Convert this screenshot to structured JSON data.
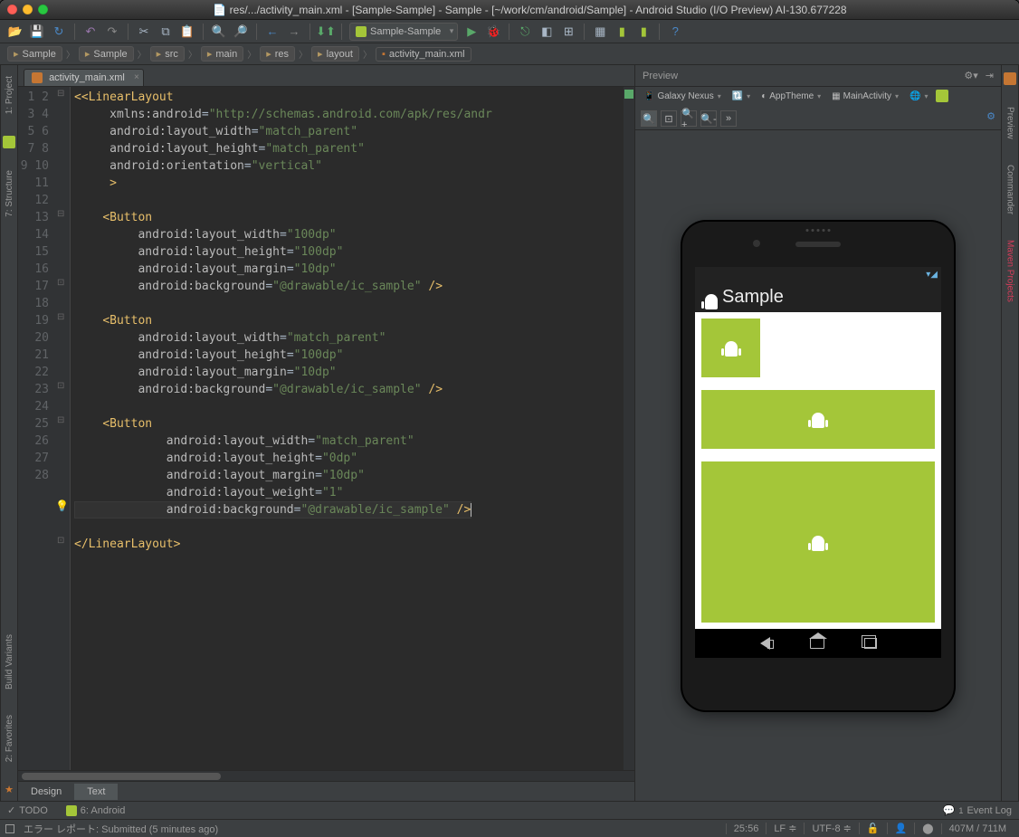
{
  "window": {
    "title": "res/.../activity_main.xml - [Sample-Sample] - Sample - [~/work/cm/android/Sample] - Android Studio (I/O Preview) AI-130.677228"
  },
  "toolbar": {
    "config": "Sample-Sample"
  },
  "breadcrumb": [
    "Sample",
    "Sample",
    "src",
    "main",
    "res",
    "layout",
    "activity_main.xml"
  ],
  "editor": {
    "tab": "activity_main.xml",
    "bottom_tabs": {
      "design": "Design",
      "text": "Text"
    },
    "line_count": 28,
    "cursor_line": 25,
    "code": {
      "l1": "<LinearLayout",
      "l2a": "xmlns:android",
      "l2b": "\"http://schemas.android.com/apk/res/andr",
      "l3a": "android:layout_width",
      "l3b": "\"match_parent\"",
      "l4a": "android:layout_height",
      "l4b": "\"match_parent\"",
      "l5a": "android:orientation",
      "l5b": "\"vertical\"",
      "l6": ">",
      "l8": "<Button",
      "l9a": "android:layout_width",
      "l9b": "\"100dp\"",
      "l10a": "android:layout_height",
      "l10b": "\"100dp\"",
      "l11a": "android:layout_margin",
      "l11b": "\"10dp\"",
      "l12a": "android:background",
      "l12b": "\"@drawable/ic_sample\"",
      "l12c": " />",
      "l14": "<Button",
      "l15a": "android:layout_width",
      "l15b": "\"match_parent\"",
      "l16a": "android:layout_height",
      "l16b": "\"100dp\"",
      "l17a": "android:layout_margin",
      "l17b": "\"10dp\"",
      "l18a": "android:background",
      "l18b": "\"@drawable/ic_sample\"",
      "l18c": " />",
      "l20": "<Button",
      "l21a": "android:layout_width",
      "l21b": "\"match_parent\"",
      "l22a": "android:layout_height",
      "l22b": "\"0dp\"",
      "l23a": "android:layout_margin",
      "l23b": "\"10dp\"",
      "l24a": "android:layout_weight",
      "l24b": "\"1\"",
      "l25a": "android:background",
      "l25b": "\"@drawable/ic_sample\"",
      "l25c": " />",
      "l27": "</LinearLayout>"
    }
  },
  "left_tabs": {
    "project": "1: Project",
    "structure": "7: Structure",
    "buildvariants": "Build Variants",
    "favorites": "2: Favorites"
  },
  "right_tabs": {
    "preview": "Preview",
    "commander": "Commander",
    "maven": "Maven Projects"
  },
  "preview": {
    "title": "Preview",
    "device": "Galaxy Nexus",
    "theme": "AppTheme",
    "activity": "MainActivity",
    "app_title": "Sample"
  },
  "toolwindows": {
    "todo": "TODO",
    "android": "6: Android",
    "eventlog": "Event Log"
  },
  "status": {
    "message": "エラー レポート: Submitted (5 minutes ago)",
    "pos": "25:56",
    "lineend": "LF",
    "encoding": "UTF-8",
    "mem": "407M / 711M",
    "eventcount": "1"
  }
}
